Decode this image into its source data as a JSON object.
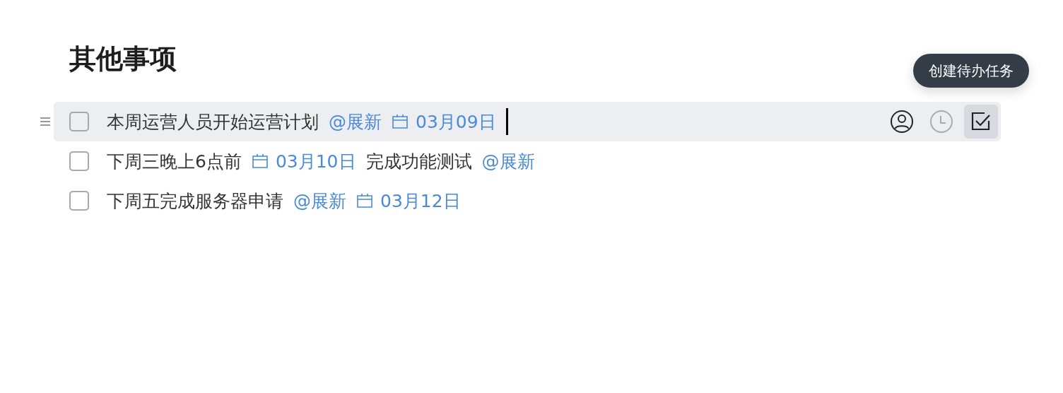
{
  "section": {
    "title": "其他事项"
  },
  "tooltip": {
    "text": "创建待办任务"
  },
  "tasks": [
    {
      "checked": false,
      "selected": true,
      "cursor": true,
      "segments": [
        {
          "kind": "text",
          "text": "本周运营人员开始运营计划"
        },
        {
          "kind": "mention",
          "text": "@展新"
        },
        {
          "kind": "date",
          "text": "03月09日"
        }
      ],
      "actions": [
        {
          "kind": "assignee",
          "selected": false,
          "disabled": false
        },
        {
          "kind": "time",
          "selected": false,
          "disabled": true
        },
        {
          "kind": "todo",
          "selected": true,
          "disabled": false
        }
      ]
    },
    {
      "checked": false,
      "selected": false,
      "cursor": false,
      "segments": [
        {
          "kind": "text",
          "text": "下周三晚上6点前"
        },
        {
          "kind": "date",
          "text": "03月10日"
        },
        {
          "kind": "text",
          "text": "完成功能测试"
        },
        {
          "kind": "mention",
          "text": "@展新"
        }
      ]
    },
    {
      "checked": false,
      "selected": false,
      "cursor": false,
      "segments": [
        {
          "kind": "text",
          "text": "下周五完成服务器申请"
        },
        {
          "kind": "mention",
          "text": "@展新"
        },
        {
          "kind": "date",
          "text": "03月12日"
        }
      ]
    }
  ]
}
